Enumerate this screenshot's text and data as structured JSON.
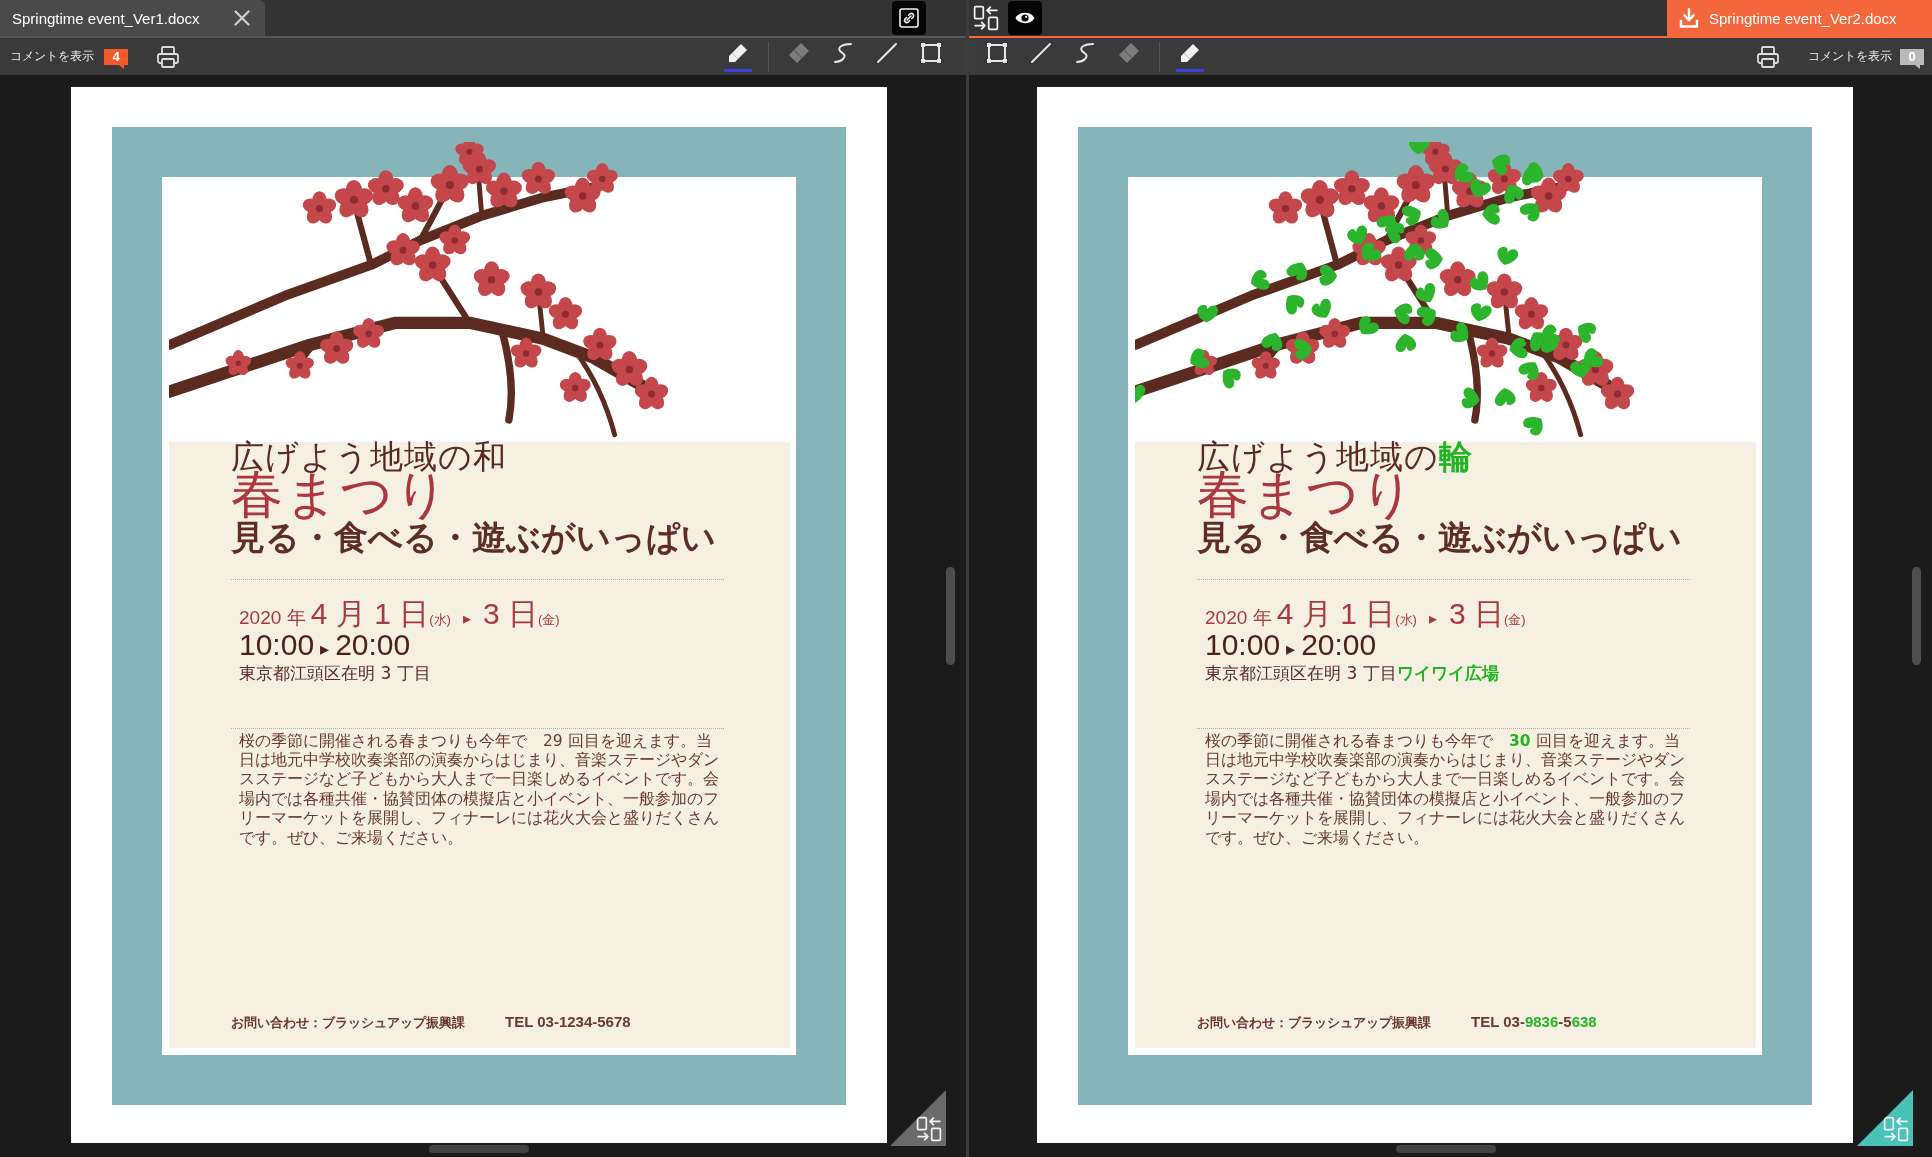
{
  "panes": [
    {
      "file_tab": {
        "label": "Springtime event_Ver1.docx",
        "kind": "closable",
        "selected": false
      },
      "view_controls": [
        {
          "kind": "link",
          "on": true
        }
      ],
      "toolbar": {
        "comments": {
          "label": "コメントを表示",
          "count": "4",
          "highlighted": true
        },
        "tools": [
          {
            "kind": "highlighter",
            "selected": true,
            "disabled": false
          },
          {
            "kind": "eraser",
            "selected": false,
            "disabled": true
          },
          {
            "kind": "freehand",
            "selected": false,
            "disabled": false
          },
          {
            "kind": "line",
            "selected": false,
            "disabled": false
          },
          {
            "kind": "rectangle",
            "selected": false,
            "disabled": false
          }
        ]
      },
      "document": {
        "illustration": {
          "changed": false
        },
        "title": "広げよう地域の和",
        "event_name": "春まつり",
        "catchphrase": "見る・食べる・遊ぶがいっぱい",
        "date": {
          "year": "2020 年",
          "start": "4 月 1 日",
          "start_weekday": "(水)",
          "arrow": "▸",
          "end": "3 日",
          "end_weekday": "(金)"
        },
        "time": {
          "start": "10:00",
          "arrow": "▸",
          "end": "20:00"
        },
        "address": "東京都江頭区在明 3 丁目",
        "description": [
          "桜の季節に開催される春まつりも今年で　29 回目を迎えます。当",
          "日は地元中学校吹奏楽部の演奏からはじまり、音楽ステージやダン",
          "スステージなど子どもから大人まで一日楽しめるイベントです。会",
          "場内では各種共催・協賛団体の模擬店と小イベント、一般参加のフ",
          "リーマーケットを展開し、フィナーレには花火大会と盛りだくさん",
          "です。ぜひ、ご来場ください。"
        ],
        "contact": "お問い合わせ：ブラッシュアップ振興課",
        "phone": "TEL 03-1234-5678"
      },
      "corner_toggle": {
        "on": false
      }
    },
    {
      "file_tab": {
        "label": "Springtime event_Ver2.docx",
        "kind": "download",
        "selected": true
      },
      "view_controls": [
        {
          "kind": "swap",
          "on": false
        },
        {
          "kind": "eye",
          "on": true
        }
      ],
      "toolbar": {
        "comments": {
          "label": "コメントを表示",
          "count": "0",
          "highlighted": false
        },
        "tools": [
          {
            "kind": "rectangle",
            "selected": false,
            "disabled": false
          },
          {
            "kind": "line",
            "selected": false,
            "disabled": false
          },
          {
            "kind": "freehand",
            "selected": false,
            "disabled": false
          },
          {
            "kind": "eraser",
            "selected": false,
            "disabled": true
          },
          {
            "kind": "highlighter",
            "selected": true,
            "disabled": false
          }
        ]
      },
      "document": {
        "illustration": {
          "changed": true
        },
        "title": [
          {
            "text": "広げよう地域の",
            "changed": false
          },
          {
            "text": "輪",
            "changed": true
          }
        ],
        "event_name": "春まつり",
        "catchphrase": "見る・食べる・遊ぶがいっぱい",
        "date": {
          "year": "2020 年",
          "start": "4 月 1 日",
          "start_weekday": "(水)",
          "arrow": "▸",
          "end": "3 日",
          "end_weekday": "(金)"
        },
        "time": {
          "start": "10:00",
          "arrow": "▸",
          "end": "20:00"
        },
        "address": [
          {
            "text": "東京都江頭区在明 3 丁目",
            "changed": false
          },
          {
            "text": "ワイワイ広場",
            "changed": true
          }
        ],
        "description": [
          [
            {
              "text": "桜の季節に開催される春まつりも今年で　",
              "changed": false
            },
            {
              "text": "30",
              "changed": true
            },
            {
              "text": " 回目を迎えます。当",
              "changed": false
            }
          ],
          "日は地元中学校吹奏楽部の演奏からはじまり、音楽ステージやダン",
          "スステージなど子どもから大人まで一日楽しめるイベントです。会",
          "場内では各種共催・協賛団体の模擬店と小イベント、一般参加のフ",
          "リーマーケットを展開し、フィナーレには花火大会と盛りだくさん",
          "です。ぜひ、ご来場ください。"
        ],
        "contact": "お問い合わせ：ブラッシュアップ振興課",
        "phone": [
          {
            "text": "TEL 03-",
            "changed": false
          },
          {
            "text": "9836",
            "changed": true
          },
          {
            "text": "-5",
            "changed": false
          },
          {
            "text": "638",
            "changed": true
          }
        ]
      },
      "corner_toggle": {
        "on": true
      }
    }
  ]
}
